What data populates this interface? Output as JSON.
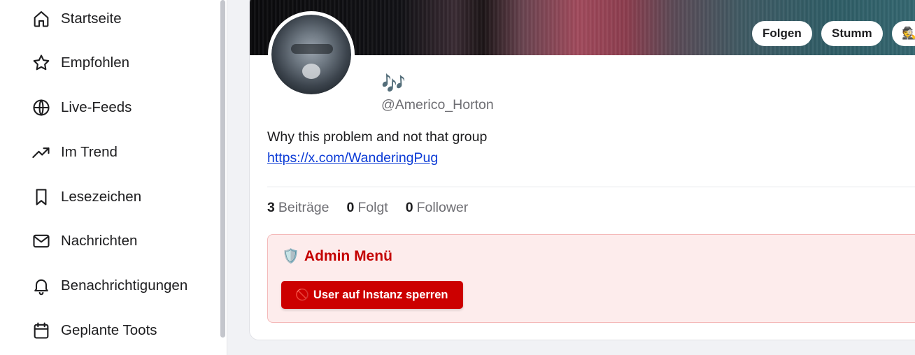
{
  "sidebar": {
    "items": [
      {
        "label": "Startseite",
        "icon": "home-icon"
      },
      {
        "label": "Empfohlen",
        "icon": "star-icon"
      },
      {
        "label": "Live-Feeds",
        "icon": "globe-icon"
      },
      {
        "label": "Im Trend",
        "icon": "trending-icon"
      },
      {
        "label": "Lesezeichen",
        "icon": "bookmark-icon"
      },
      {
        "label": "Nachrichten",
        "icon": "mail-icon"
      },
      {
        "label": "Benachrichtigungen",
        "icon": "bell-icon"
      },
      {
        "label": "Geplante Toots",
        "icon": "calendar-icon"
      }
    ]
  },
  "profile": {
    "display_name": "🎶",
    "handle": "@Americo_Horton",
    "bio": "Why this problem and not that group",
    "link": "https://x.com/WanderingPug",
    "actions": {
      "follow_label": "Folgen",
      "mute_label": "Stumm",
      "spy_icon": "🕵"
    },
    "stats": {
      "posts_count": "3",
      "posts_label": "Beiträge",
      "following_count": "0",
      "following_label": "Folgt",
      "followers_count": "0",
      "followers_label": "Follower"
    }
  },
  "admin": {
    "shield_icon": "🛡️",
    "title": "Admin Menü",
    "ban_icon": "🚫",
    "ban_label": "User auf Instanz sperren"
  },
  "colors": {
    "admin_accent": "#cc0000",
    "admin_background": "#fdecec",
    "link": "#0b3bd6"
  }
}
